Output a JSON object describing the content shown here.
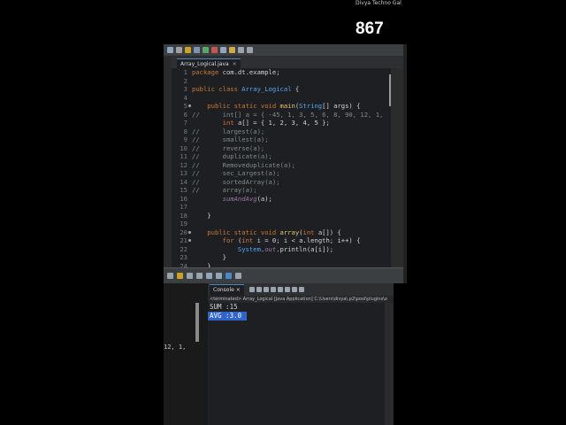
{
  "overlay": {
    "watermark": "Divya Techno Gal",
    "counter": "867"
  },
  "editor": {
    "tab_label": "Array_Logical.java",
    "tab_close": "×",
    "lines": [
      {
        "n": "1",
        "t": [
          [
            "kw",
            "package "
          ],
          [
            "",
            "com.dt.example;"
          ]
        ]
      },
      {
        "n": "2",
        "t": []
      },
      {
        "n": "3",
        "t": [
          [
            "kw",
            "public class "
          ],
          [
            "ty",
            "Array_Logical"
          ],
          [
            "",
            " {"
          ]
        ]
      },
      {
        "n": "4",
        "t": []
      },
      {
        "n": "5",
        "m": true,
        "t": [
          [
            "kw",
            "    public static void "
          ],
          [
            "fn",
            "main"
          ],
          [
            "",
            "("
          ],
          [
            "ty",
            "String"
          ],
          [
            "",
            "[] args) {"
          ]
        ]
      },
      {
        "n": "6",
        "t": [
          [
            "cm",
            "//      int[] a = { -45, 1, 3, 5, 6, 8, 90, 12, 1,"
          ]
        ]
      },
      {
        "n": "7",
        "t": [
          [
            "kw",
            "        int "
          ],
          [
            "",
            "a[] = { 1, 2, 3, 4, 5 };"
          ]
        ]
      },
      {
        "n": "8",
        "t": [
          [
            "cm",
            "//      largest(a);"
          ]
        ]
      },
      {
        "n": "9",
        "t": [
          [
            "cm",
            "//      smallest(a);"
          ]
        ]
      },
      {
        "n": "10",
        "t": [
          [
            "cm",
            "//      reverse(a);"
          ]
        ]
      },
      {
        "n": "11",
        "t": [
          [
            "cm",
            "//      duplicate(a);"
          ]
        ]
      },
      {
        "n": "12",
        "t": [
          [
            "cm",
            "//      Removeduplicate(a);"
          ]
        ]
      },
      {
        "n": "13",
        "t": [
          [
            "cm",
            "//      sec_Largest(a);"
          ]
        ]
      },
      {
        "n": "14",
        "t": [
          [
            "cm",
            "//      sortedArray(a);"
          ]
        ]
      },
      {
        "n": "15",
        "t": [
          [
            "cm",
            "//      array(a);"
          ]
        ]
      },
      {
        "n": "16",
        "t": [
          [
            "fld",
            "        sumAndAvg"
          ],
          [
            "",
            "(a);"
          ]
        ]
      },
      {
        "n": "17",
        "t": []
      },
      {
        "n": "18",
        "t": [
          [
            "",
            "    }"
          ]
        ]
      },
      {
        "n": "19",
        "t": []
      },
      {
        "n": "20",
        "m": true,
        "t": [
          [
            "kw",
            "    public static void "
          ],
          [
            "fn",
            "array"
          ],
          [
            "",
            "("
          ],
          [
            "kw",
            "int "
          ],
          [
            "",
            "a[]) {"
          ]
        ]
      },
      {
        "n": "21",
        "m": true,
        "t": [
          [
            "kw",
            "        for "
          ],
          [
            "",
            "("
          ],
          [
            "kw",
            "int "
          ],
          [
            "",
            "i = 0; i < a.length; i++) {"
          ]
        ]
      },
      {
        "n": "22",
        "t": [
          [
            "ty",
            "            System"
          ],
          [
            "",
            "."
          ],
          [
            "fld",
            "out"
          ],
          [
            "",
            ".println(a[i]);"
          ]
        ]
      },
      {
        "n": "23",
        "t": [
          [
            "",
            "        }"
          ]
        ]
      },
      {
        "n": "24",
        "t": [
          [
            "",
            "    }"
          ]
        ]
      }
    ]
  },
  "left_pane": {
    "clipped_code": "12, 1,"
  },
  "console": {
    "tab_label": "Console",
    "tab_close": "×",
    "status": "<terminated> Array_Logical [Java Application] C:\\Users\\divya\\.p2\\pool\\plugins\\o",
    "lines": [
      "SUM :15",
      "AVG :3.0"
    ],
    "selected_index": 1
  },
  "colors": {
    "editor_bg": "#1e1f22",
    "keyword": "#cc7832",
    "type": "#56a8f5",
    "selection": "#2f65ca"
  }
}
